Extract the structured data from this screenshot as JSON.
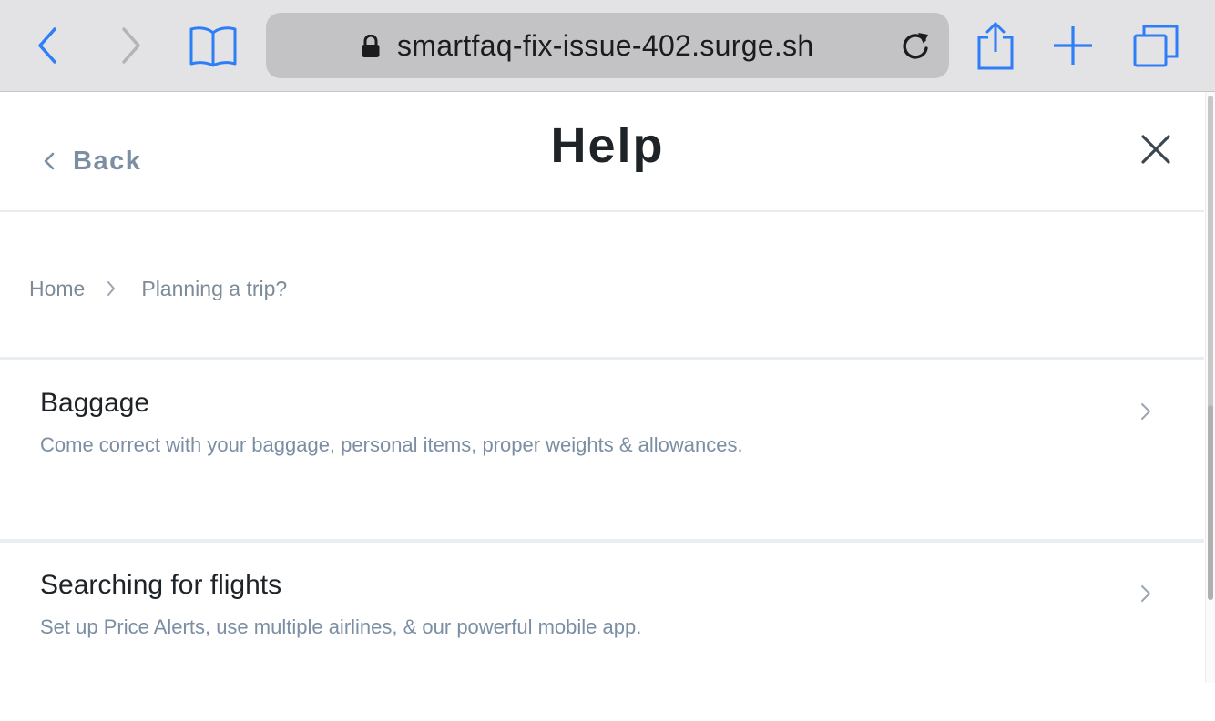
{
  "browser": {
    "url": "smartfaq-fix-issue-402.surge.sh",
    "icons": {
      "back": "chevron-left-icon",
      "forward": "chevron-right-icon",
      "bookmarks": "book-icon",
      "lock": "lock-icon",
      "reload": "reload-icon",
      "share": "share-icon",
      "new_tab": "plus-icon",
      "tabs": "tabs-icon"
    },
    "accent": "#2d7ef7"
  },
  "header": {
    "back_label": "Back",
    "title": "Help",
    "close_icon": "close-icon"
  },
  "breadcrumb": {
    "items": [
      "Home",
      "Planning a trip?"
    ]
  },
  "topics": [
    {
      "title": "Baggage",
      "description": "Come correct with your baggage, personal items, proper weights & allowances."
    },
    {
      "title": "Searching for flights",
      "description": "Set up Price Alerts, use multiple airlines, & our powerful mobile app."
    }
  ],
  "colors": {
    "title_text": "#1e2328",
    "muted_text": "#7b8ea3",
    "divider": "#e9eef3"
  }
}
